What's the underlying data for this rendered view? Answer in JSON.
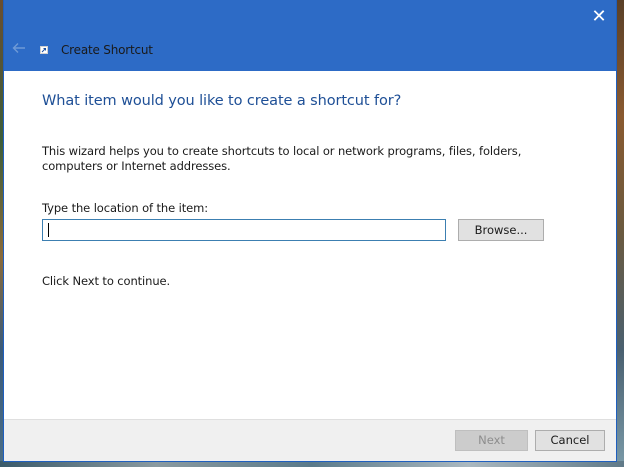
{
  "window": {
    "title": "Create Shortcut",
    "close_glyph": "✕",
    "back_icon": "back-arrow-icon",
    "app_icon": "shortcut-icon",
    "accent_color": "#2d6bc6"
  },
  "content": {
    "heading": "What item would you like to create a shortcut for?",
    "description": "This wizard helps you to create shortcuts to local or network programs, files, folders, computers or Internet addresses.",
    "location_label": "Type the location of the item:",
    "location_value": "",
    "browse_label": "Browse...",
    "continue_text": "Click Next to continue."
  },
  "footer": {
    "next_label": "Next",
    "next_enabled": false,
    "cancel_label": "Cancel"
  }
}
